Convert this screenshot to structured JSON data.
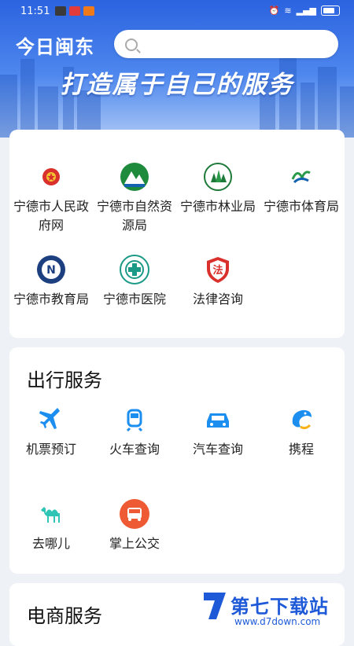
{
  "status": {
    "time": "11:51"
  },
  "app": {
    "title": "今日闽东",
    "slogan": "打造属于自己的服务"
  },
  "search": {
    "placeholder": ""
  },
  "gov": {
    "items": [
      {
        "label": "宁德市人民政府网",
        "icon": "national-emblem-icon"
      },
      {
        "label": "宁德市自然资源局",
        "icon": "mountain-logo-icon"
      },
      {
        "label": "宁德市林业局",
        "icon": "forestry-logo-icon"
      },
      {
        "label": "宁德市体育局",
        "icon": "sports-logo-icon"
      },
      {
        "label": "宁德市教育局",
        "icon": "education-logo-icon"
      },
      {
        "label": "宁德市医院",
        "icon": "hospital-logo-icon"
      },
      {
        "label": "法律咨询",
        "icon": "law-shield-icon"
      }
    ]
  },
  "travel": {
    "title": "出行服务",
    "items": [
      {
        "label": "机票预订",
        "icon": "plane-icon"
      },
      {
        "label": "火车查询",
        "icon": "train-icon"
      },
      {
        "label": "汽车查询",
        "icon": "car-icon"
      },
      {
        "label": "携程",
        "icon": "dolphin-icon"
      },
      {
        "label": "去哪儿",
        "icon": "camel-icon"
      },
      {
        "label": "掌上公交",
        "icon": "bus-icon"
      }
    ]
  },
  "ecommerce": {
    "title": "电商服务"
  },
  "watermark": {
    "name": "第七下载站",
    "url": "www.d7down.com"
  },
  "colors": {
    "primary": "#2b63e0",
    "accent": "#1b8ef0",
    "law_red": "#d9302b"
  }
}
